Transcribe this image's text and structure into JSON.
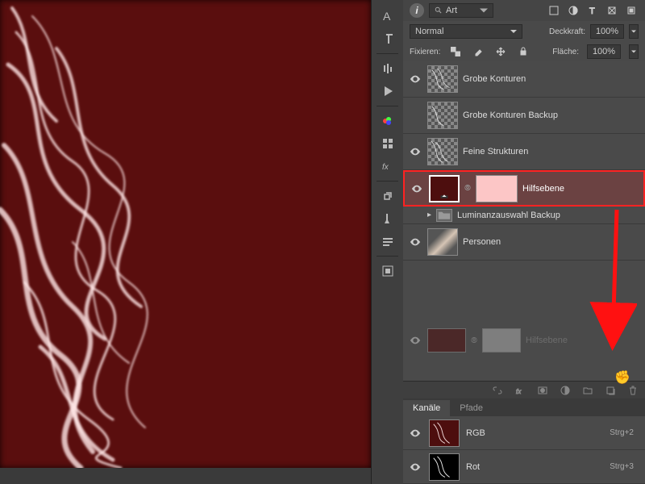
{
  "header": {
    "search_placeholder": "Art",
    "blend_mode": "Normal",
    "opacity_label": "Deckkraft:",
    "opacity_value": "100%",
    "fill_label": "Fläche:",
    "fill_value": "100%",
    "lock_label": "Fixieren:"
  },
  "layers": [
    {
      "name": "Grobe Konturen",
      "visible": true,
      "thumb": "checker"
    },
    {
      "name": "Grobe Konturen Backup",
      "visible": false,
      "thumb": "checker"
    },
    {
      "name": "Feine Strukturen",
      "visible": true,
      "thumb": "checker"
    },
    {
      "name": "Hilfsebene",
      "visible": true,
      "thumb": "dark-red",
      "mask": "pink",
      "selected": true
    },
    {
      "name": "Luminanzauswahl Backup",
      "visible": false,
      "group": true
    },
    {
      "name": "Personen",
      "visible": true,
      "thumb": "photo"
    }
  ],
  "drag_ghost": {
    "name": "Hilfsebene",
    "thumb": "dark-red",
    "mask": "grey"
  },
  "tabs": {
    "channels": "Kanäle",
    "paths": "Pfade"
  },
  "channels": [
    {
      "name": "RGB",
      "shortcut": "Strg+2"
    },
    {
      "name": "Rot",
      "shortcut": "Strg+3"
    }
  ]
}
